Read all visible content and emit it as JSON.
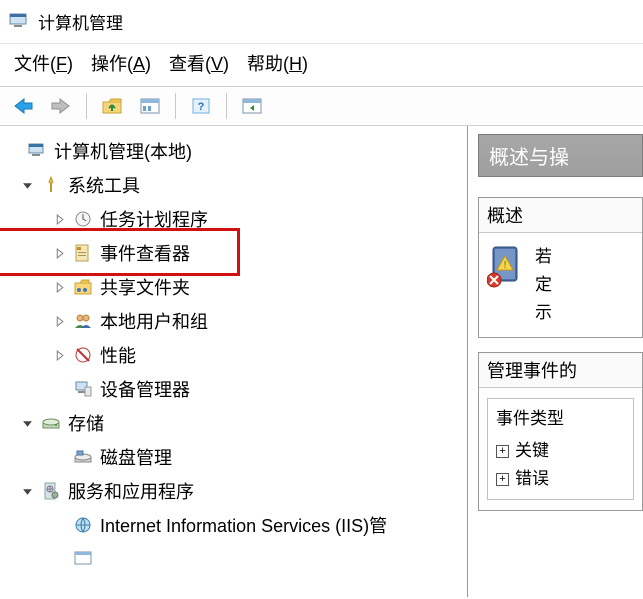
{
  "title": "计算机管理",
  "menu": {
    "file": {
      "label": "文件",
      "hotkey": "F"
    },
    "action": {
      "label": "操作",
      "hotkey": "A"
    },
    "view": {
      "label": "查看",
      "hotkey": "V"
    },
    "help": {
      "label": "帮助",
      "hotkey": "H"
    }
  },
  "tree": {
    "root": {
      "label": "计算机管理(本地)"
    },
    "systools": {
      "label": "系统工具",
      "children": {
        "scheduler": "任务计划程序",
        "eventviewer": "事件查看器",
        "shared": "共享文件夹",
        "users": "本地用户和组",
        "perf": "性能",
        "devmgr": "设备管理器"
      }
    },
    "storage": {
      "label": "存储",
      "children": {
        "diskmgr": "磁盘管理"
      }
    },
    "svcapps": {
      "label": "服务和应用程序",
      "children": {
        "iis": "Internet Information Services (IIS)管"
      }
    }
  },
  "detail": {
    "header": "概述与操",
    "overview_title": "概述",
    "overview_text1": "若",
    "overview_text2": "定",
    "overview_text3": "示",
    "mgmt_title": "管理事件的",
    "eventtypes_title": "事件类型",
    "items": {
      "critical": "关键",
      "error": "错误"
    }
  }
}
